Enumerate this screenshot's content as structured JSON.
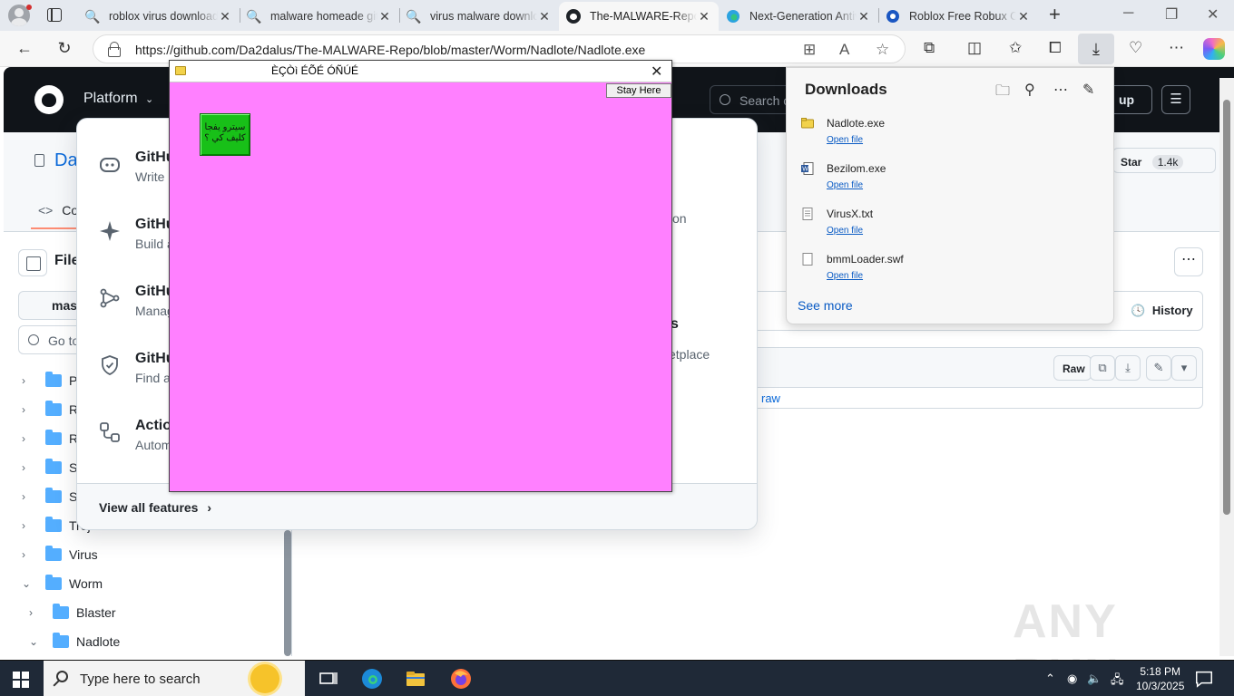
{
  "browser": {
    "tabs": [
      {
        "label": "roblox virus download",
        "icon": "search-icon",
        "active": false
      },
      {
        "label": "malware homeade github",
        "icon": "search-icon",
        "active": false
      },
      {
        "label": "virus malware download",
        "icon": "search-icon",
        "active": false
      },
      {
        "label": "The-MALWARE-Repo/",
        "icon": "github-icon",
        "active": true
      },
      {
        "label": "Next-Generation Antivirus",
        "icon": "edge-logo-icon",
        "active": false
      },
      {
        "label": "Roblox Free Robux Co",
        "icon": "globe-icon",
        "active": false
      }
    ],
    "url": "https://github.com/Da2dalus/The-MALWARE-Repo/blob/master/Worm/Nadlote/Nadlote.exe"
  },
  "github": {
    "platform_label": "Platform",
    "search_placeholder": "Search c",
    "signup_label": "up",
    "repo_name": "Da",
    "star_label": "Star",
    "star_count": "1.4k",
    "code_tab": "Co",
    "files_title": "File",
    "branch": "mast",
    "goto_placeholder": "Go to",
    "tree": [
      {
        "name": "Po",
        "level": 0,
        "open": false
      },
      {
        "name": "RA",
        "level": 0,
        "open": false
      },
      {
        "name": "Ra",
        "level": 0,
        "open": false
      },
      {
        "name": "Sp",
        "level": 0,
        "open": false
      },
      {
        "name": "Ste",
        "level": 0,
        "open": false
      },
      {
        "name": "Troja",
        "level": 0,
        "open": false
      },
      {
        "name": "Virus",
        "level": 0,
        "open": false
      },
      {
        "name": "Worm",
        "level": 0,
        "open": true
      },
      {
        "name": "Blaster",
        "level": 1,
        "open": false
      },
      {
        "name": "Nadlote",
        "level": 1,
        "open": true
      }
    ],
    "history_label": "History",
    "raw_label": "Raw",
    "view_raw": "raw",
    "watermark": "ANY RUN"
  },
  "platform_menu": {
    "items": [
      {
        "title": "GitHu",
        "desc": "Write"
      },
      {
        "title": "GitHu",
        "desc": "Build a"
      },
      {
        "title": "GitHu",
        "desc": "Manag"
      },
      {
        "title": "GitHu",
        "desc": "Find a"
      },
      {
        "title": "Actio",
        "desc": "Autom"
      }
    ],
    "fragments": {
      "on": "on",
      "s": "s",
      "etplace": "etplace"
    },
    "view_all": "View all features"
  },
  "popup": {
    "title": "ÈÇÒì ÉÕÉ ÓÑÚÉ",
    "stay_button": "Stay Here",
    "green_text": "سيترو يفجا كليف كي ؟"
  },
  "downloads": {
    "title": "Downloads",
    "items": [
      {
        "file": "Nadlote.exe",
        "action": "Open file",
        "icon": "folder-icon"
      },
      {
        "file": "Bezilom.exe",
        "action": "Open file",
        "icon": "word-icon"
      },
      {
        "file": "VirusX.txt",
        "action": "Open file",
        "icon": "text-file-icon"
      },
      {
        "file": "bmmLoader.swf",
        "action": "Open file",
        "icon": "file-icon"
      }
    ],
    "see_more": "See more"
  },
  "taskbar": {
    "search_placeholder": "Type here to search",
    "time": "5:18 PM",
    "date": "10/3/2025"
  }
}
